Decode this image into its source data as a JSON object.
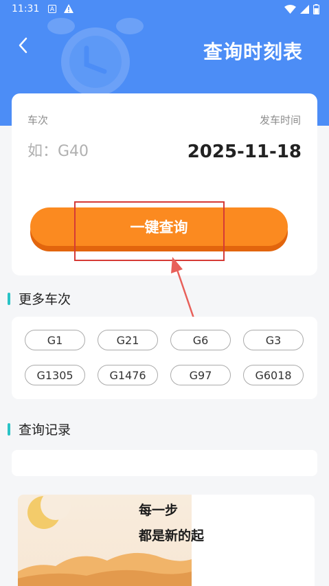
{
  "status_bar": {
    "time": "11:31",
    "icons": [
      "a-box-icon",
      "warning-icon",
      "wifi-icon",
      "signal-icon",
      "battery-icon"
    ]
  },
  "header": {
    "back_icon": "chevron-left-icon",
    "title": "查询时刻表",
    "decor_icon": "alarm-clock-icon"
  },
  "search_card": {
    "train_label": "车次",
    "train_placeholder": "如：G40",
    "train_value": "",
    "departure_label": "发车时间",
    "departure_date": "2025-11-18",
    "query_button": "一键查询"
  },
  "more_trains": {
    "title": "更多车次",
    "items": [
      "G1",
      "G21",
      "G6",
      "G3",
      "G1305",
      "G1476",
      "G97",
      "G6018"
    ]
  },
  "history": {
    "title": "查询记录",
    "items": []
  },
  "ad": {
    "line1": "每一步",
    "line2": "都是新的起"
  },
  "colors": {
    "header_blue": "#4c8df6",
    "button_orange": "#fb8a20",
    "section_accent": "#29c3c6",
    "annotation_red": "#d53a36"
  }
}
